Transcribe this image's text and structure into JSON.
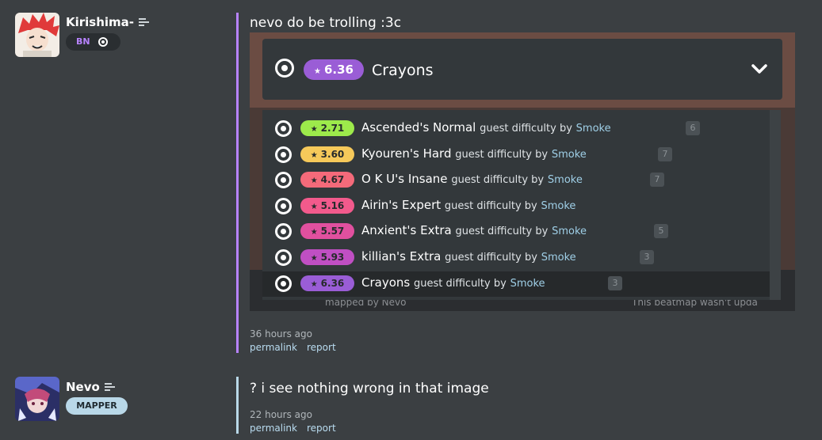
{
  "posts": [
    {
      "user": {
        "name": "Kirishima-",
        "badge": "BN",
        "avatar_icon": "kirishima-avatar",
        "accent": "#b783ff"
      },
      "message": "nevo do be trolling :3c",
      "time": "36 hours ago",
      "links": [
        "permalink",
        "report"
      ]
    },
    {
      "user": {
        "name": "Nevo",
        "badge": "MAPPER",
        "avatar_icon": "nevo-avatar",
        "accent": "#b9d8e8"
      },
      "message": "? i see nothing wrong in that image",
      "time": "22 hours ago",
      "links": [
        "permalink",
        "report"
      ]
    }
  ],
  "screenshot": {
    "selected": {
      "stars": "6.36",
      "name": "Crayons",
      "color": "#9a5dd6"
    },
    "difficulties": [
      {
        "stars": "2.71",
        "name": "Ascended's Normal",
        "guest": "guest difficulty by",
        "mapper": "Smoke",
        "count": "6",
        "color": "#9dea4b"
      },
      {
        "stars": "3.60",
        "name": "Kyouren's Hard",
        "guest": "guest difficulty by",
        "mapper": "Smoke",
        "count": "7",
        "color": "#f6c95a"
      },
      {
        "stars": "4.67",
        "name": "O K U's Insane",
        "guest": "guest difficulty by",
        "mapper": "Smoke",
        "count": "7",
        "color": "#f46a7a"
      },
      {
        "stars": "5.16",
        "name": "Airin's Expert",
        "guest": "guest difficulty by",
        "mapper": "Smoke",
        "count": "",
        "color": "#f25a8c"
      },
      {
        "stars": "5.57",
        "name": "Anxient's Extra",
        "guest": "guest difficulty by",
        "mapper": "Smoke",
        "count": "5",
        "color": "#e1509f"
      },
      {
        "stars": "5.93",
        "name": "killian's Extra",
        "guest": "guest difficulty by",
        "mapper": "Smoke",
        "count": "3",
        "color": "#c04fc3"
      },
      {
        "stars": "6.36",
        "name": "Crayons",
        "guest": "guest difficulty by",
        "mapper": "Smoke",
        "count": "3",
        "color": "#9a5dd6"
      }
    ],
    "faint_left": "mapped by Nevo",
    "faint_right": "This beatmap wasn't upda"
  }
}
